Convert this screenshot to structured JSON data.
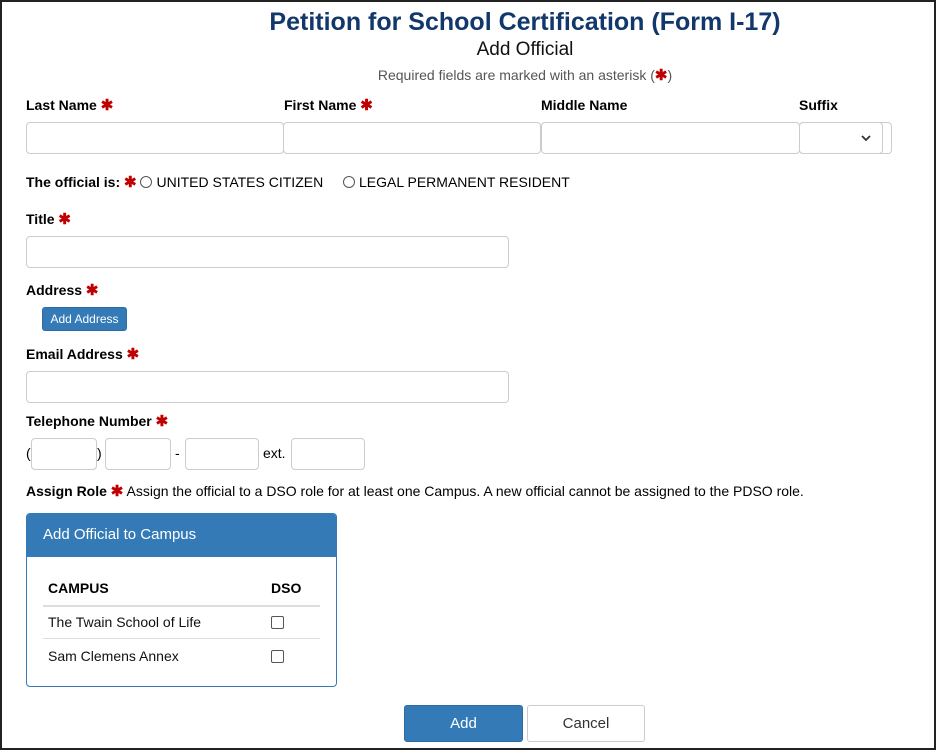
{
  "header": {
    "title": "Petition for School Certification (Form I-17)",
    "subtitle": "Add Official",
    "required_note_prefix": "Required fields are marked with an asterisk (",
    "required_note_suffix": ")",
    "required_icon": "asterisk-icon"
  },
  "fields": {
    "last_name": {
      "label": "Last Name",
      "value": "",
      "required": true
    },
    "first_name": {
      "label": "First Name",
      "value": "",
      "required": true
    },
    "middle_name": {
      "label": "Middle Name",
      "value": "",
      "required": false
    },
    "suffix": {
      "label": "Suffix",
      "value": "",
      "required": false
    },
    "status": {
      "label": "The official is:",
      "options": [
        "UNITED STATES CITIZEN",
        "LEGAL PERMANENT RESIDENT"
      ],
      "selected": null
    },
    "title": {
      "label": "Title",
      "value": ""
    },
    "address": {
      "label": "Address",
      "button": "Add Address"
    },
    "email": {
      "label": "Email Address",
      "value": ""
    },
    "telephone": {
      "label": "Telephone Number",
      "open_paren": "(",
      "close_paren": ")",
      "dash": "-",
      "ext_label": "ext.",
      "area": "",
      "prefix": "",
      "line": "",
      "ext": ""
    },
    "assign_role": {
      "label": "Assign Role",
      "description": "Assign the official to a DSO role for at least one Campus. A new official cannot be assigned to the PDSO role."
    }
  },
  "campus_panel": {
    "title": "Add Official to Campus",
    "columns": [
      "CAMPUS",
      "DSO"
    ],
    "rows": [
      {
        "campus": "The Twain School of Life",
        "dso": false
      },
      {
        "campus": "Sam Clemens Annex",
        "dso": false
      }
    ]
  },
  "actions": {
    "add": "Add",
    "cancel": "Cancel"
  },
  "colors": {
    "title": "#12386b",
    "primary": "#337ab7",
    "required": "#c00000"
  }
}
